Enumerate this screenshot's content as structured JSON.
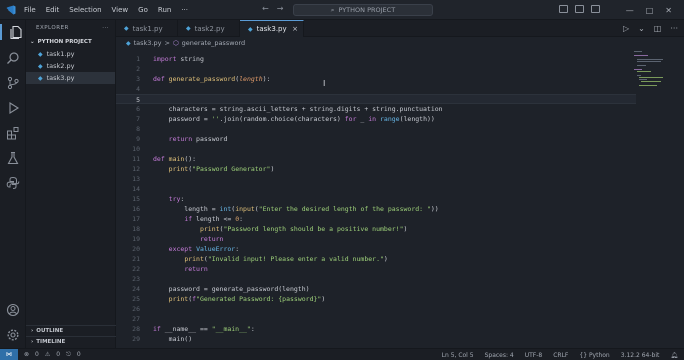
{
  "menu": [
    "File",
    "Edit",
    "Selection",
    "View",
    "Go",
    "Run",
    "···"
  ],
  "search": {
    "label": "PYTHON PROJECT"
  },
  "sidebar": {
    "title": "EXPLORER",
    "more": "···",
    "folder": "PYTHON PROJECT",
    "files": [
      "task1.py",
      "task2.py",
      "task3.py"
    ],
    "active_file": "task3.py",
    "sections": [
      "OUTLINE",
      "TIMELINE"
    ]
  },
  "tabs": [
    {
      "label": "task1.py",
      "active": false
    },
    {
      "label": "task2.py",
      "active": false
    },
    {
      "label": "task3.py",
      "active": true,
      "close": "×"
    }
  ],
  "breadcrumb": {
    "file": "task3.py",
    "sep": ">",
    "symbol": "generate_password"
  },
  "editor": {
    "current_line": 5,
    "lines": [
      {
        "n": "1",
        "code": ""
      },
      {
        "n": "2",
        "code": ""
      },
      {
        "n": "3",
        "code": ""
      },
      {
        "n": "4",
        "code": ""
      },
      {
        "n": "5",
        "code": ""
      },
      {
        "n": "6",
        "code": ""
      },
      {
        "n": "7",
        "code": ""
      },
      {
        "n": "8",
        "code": ""
      },
      {
        "n": "9",
        "code": ""
      },
      {
        "n": "10",
        "code": ""
      },
      {
        "n": "11",
        "code": ""
      },
      {
        "n": "12",
        "code": ""
      },
      {
        "n": "13",
        "code": ""
      },
      {
        "n": "14",
        "code": ""
      },
      {
        "n": "15",
        "code": ""
      },
      {
        "n": "16",
        "code": ""
      },
      {
        "n": "17",
        "code": ""
      },
      {
        "n": "18",
        "code": ""
      },
      {
        "n": "19",
        "code": ""
      },
      {
        "n": "20",
        "code": ""
      },
      {
        "n": "21",
        "code": ""
      },
      {
        "n": "22",
        "code": ""
      },
      {
        "n": "23",
        "code": ""
      },
      {
        "n": "24",
        "code": ""
      },
      {
        "n": "25",
        "code": ""
      },
      {
        "n": "26",
        "code": ""
      },
      {
        "n": "27",
        "code": ""
      },
      {
        "n": "28",
        "code": ""
      },
      {
        "n": "29",
        "code": ""
      }
    ]
  },
  "status": {
    "errors": "0",
    "warnings": "0",
    "ports": "0",
    "position": "Ln 5, Col 5",
    "spaces": "Spaces: 4",
    "encoding": "UTF-8",
    "eol": "CRLF",
    "language": "Python",
    "interpreter": "3.12.2 64-bit"
  },
  "colors": {
    "background": "#1e2229",
    "accent": "#5b9bd5",
    "keyword": "#c77ddb",
    "function": "#e2c27a",
    "string": "#9fd27a"
  }
}
